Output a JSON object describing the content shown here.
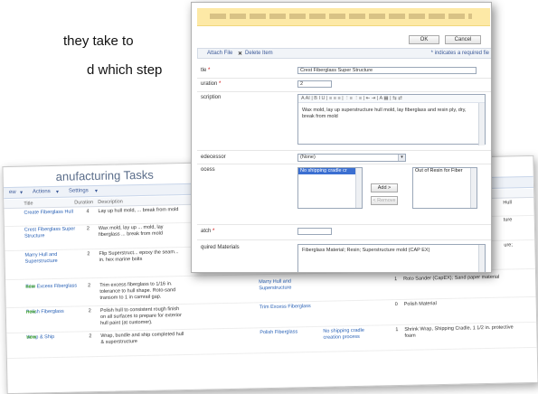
{
  "doc_text": {
    "line1": "they take to",
    "line2": "d which step"
  },
  "list": {
    "title": "anufacturing Tasks",
    "toolbar": {
      "new": "ew",
      "actions": "Actions",
      "settings": "Settings"
    },
    "columns": {
      "title": "Title",
      "duration": "Duration",
      "description": "Description"
    },
    "rows": [
      {
        "title": "Create Fiberglass Hull",
        "duration": "4",
        "desc": "Lay up hull mold, ... break from mold",
        "new": "",
        "pred": "",
        "proc": "",
        "num": "",
        "mat": "",
        "clip": "Hull"
      },
      {
        "title": "Crest Fiberglass Super Structure",
        "duration": "2",
        "desc": "Wax mold, lay up ... mold, lay fiberglass ... break from mold",
        "new": "",
        "pred": "",
        "proc": "",
        "num": "",
        "mat": "",
        "clip": "ture"
      },
      {
        "title": "Marry Hull and Superstructure",
        "duration": "2",
        "desc": "Flip Superstruct... epoxy the seam... in. hex marine bolts",
        "new": "",
        "pred": "",
        "proc": "",
        "num": "",
        "mat": "",
        "clip": "ure;"
      },
      {
        "title": "Trim Excess Fiberglass",
        "duration": "2",
        "desc": "Trim excess fiberglass to 1/16 in. tolerance to hull shape. Roto-sand transom to 1 in camrail gap.",
        "new": "new",
        "pred": "Marry Hull and Superstructure",
        "proc": "",
        "num": "1",
        "mat": "Roto Sander (CapEX); Sand paper material",
        "clip": ""
      },
      {
        "title": "Polish Fiberglass",
        "duration": "2",
        "desc": "Polish hull to consistent rough finish on all surfaces to prepare for exterior hull paint (at customer).",
        "new": "new",
        "pred": "Trim Excess Fiberglass",
        "proc": "",
        "num": "0",
        "mat": "Polish Material",
        "clip": ""
      },
      {
        "title": "Wrap & Ship",
        "duration": "2",
        "desc": "Wrap, bundle and ship completed hull & superstructure",
        "new": "new",
        "pred": "Polish Fiberglass",
        "proc": "No shipping cradle creation process",
        "num": "1",
        "mat": "Shrink Wrap, Shipping Cradle, 1 1/2 in. protective foam",
        "clip": ""
      }
    ]
  },
  "form": {
    "buttons": {
      "ok": "OK",
      "cancel": "Cancel"
    },
    "toolbar": {
      "attach": "Attach File",
      "delete": "Delete Item"
    },
    "required_note": "* indicates a required fie",
    "fields": {
      "title": {
        "label": "tle",
        "value": "Crest Fiberglass Super Structure"
      },
      "duration": {
        "label": "uration",
        "value": "2"
      },
      "description": {
        "label": "scription",
        "toolbar": "A  AI | B  I  U | ≡ ≡ ≡ | ⋮≡ ⋮≡ | ⇤ ⇥ | A  ▦ | ⇆ ⇄",
        "value": "Wax mold, lay up superstructure hull mold, lay fiberglass and resin ply, dry, break from mold"
      },
      "predecessor": {
        "label": "edecessor",
        "value": "(None)"
      },
      "process": {
        "label": "ocess",
        "selected": "No shipping cradle cr",
        "available": "Out of Resin for Fiber",
        "add": "Add >",
        "remove": "< Remove"
      },
      "batch": {
        "label": "atch",
        "value": ""
      },
      "materials": {
        "label": "quired Materials",
        "value": "Fiberglass Material; Resin; Superstructure mold (CAP EX)"
      }
    }
  }
}
